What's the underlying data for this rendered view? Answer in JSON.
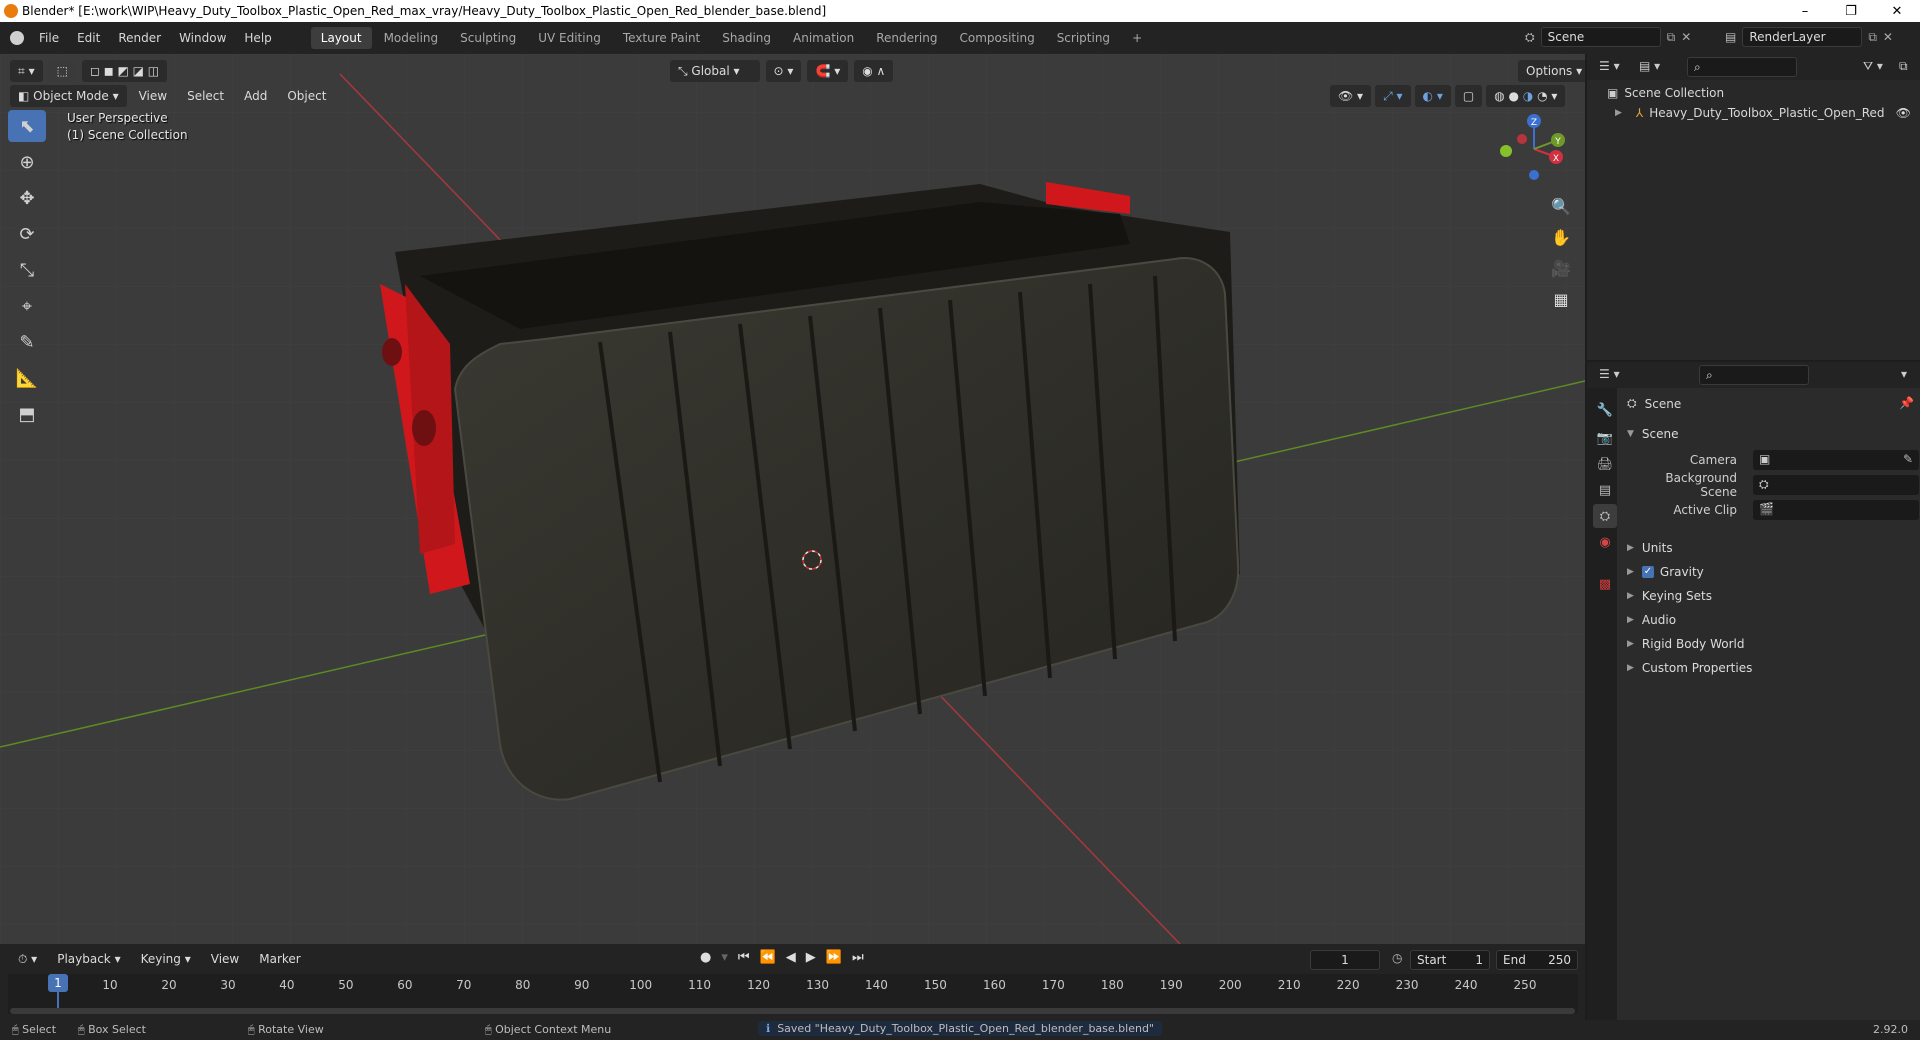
{
  "titlebar": {
    "title": "Blender* [E:\\work\\WIP\\Heavy_Duty_Toolbox_Plastic_Open_Red_max_vray/Heavy_Duty_Toolbox_Plastic_Open_Red_blender_base.blend]",
    "minimize": "–",
    "maximize": "❐",
    "close": "✕"
  },
  "menu": {
    "file": "File",
    "edit": "Edit",
    "render": "Render",
    "window": "Window",
    "help": "Help"
  },
  "workspaces": [
    "Layout",
    "Modeling",
    "Sculpting",
    "UV Editing",
    "Texture Paint",
    "Shading",
    "Animation",
    "Rendering",
    "Compositing",
    "Scripting"
  ],
  "active_workspace": "Layout",
  "scene": {
    "name": "Scene",
    "render_layer": "RenderLayer"
  },
  "viewport": {
    "mode": "Object Mode",
    "menus": {
      "view": "View",
      "select": "Select",
      "add": "Add",
      "object": "Object"
    },
    "transform_orientation": "Global",
    "options": "Options",
    "perspective": "User Perspective",
    "collection": "(1) Scene Collection",
    "gizmo": {
      "x": "X",
      "y": "Y",
      "z": "Z"
    }
  },
  "outliner": {
    "root": "Scene Collection",
    "items": [
      {
        "name": "Heavy_Duty_Toolbox_Plastic_Open_Red"
      }
    ]
  },
  "properties": {
    "context": "Scene",
    "panel": "Scene",
    "camera_label": "Camera",
    "background_scene_label": "Background Scene",
    "active_clip_label": "Active Clip",
    "subpanels": [
      "Units",
      "Gravity",
      "Keying Sets",
      "Audio",
      "Rigid Body World",
      "Custom Properties"
    ],
    "gravity_enabled": true
  },
  "timeline": {
    "menus": {
      "playback": "Playback",
      "keying": "Keying",
      "view": "View",
      "marker": "Marker"
    },
    "current_frame": "1",
    "start_label": "Start",
    "start": "1",
    "end_label": "End",
    "end": "250",
    "ticks": [
      "1",
      "10",
      "20",
      "30",
      "40",
      "50",
      "60",
      "70",
      "80",
      "90",
      "100",
      "110",
      "120",
      "130",
      "140",
      "150",
      "160",
      "170",
      "180",
      "190",
      "200",
      "210",
      "220",
      "230",
      "240",
      "250"
    ]
  },
  "status": {
    "select": "Select",
    "box_select": "Box Select",
    "rotate_view": "Rotate View",
    "context_menu": "Object Context Menu",
    "message": "Saved \"Heavy_Duty_Toolbox_Plastic_Open_Red_blender_base.blend\"",
    "version": "2.92.0"
  },
  "colors": {
    "accent": "#4772b3",
    "axis_x": "#c8323c",
    "axis_y": "#6f9a2a",
    "toolbox_body": "#2e2d27",
    "toolbox_red": "#d0181c"
  }
}
